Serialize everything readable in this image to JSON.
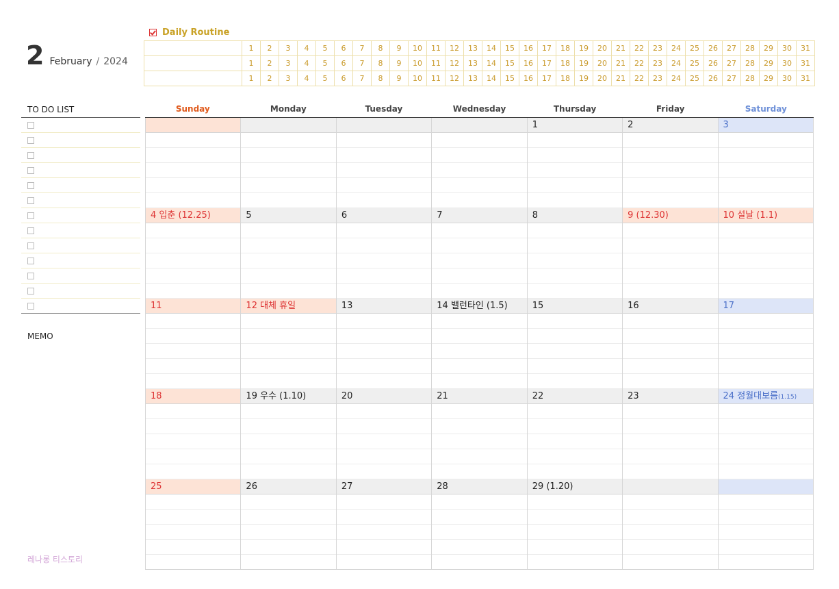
{
  "header": {
    "month_num": "2",
    "month_name": "February",
    "sep": "/",
    "year": "2024"
  },
  "routine": {
    "title": "Daily Routine",
    "days": [
      "1",
      "2",
      "3",
      "4",
      "5",
      "6",
      "7",
      "8",
      "9",
      "10",
      "11",
      "12",
      "13",
      "14",
      "15",
      "16",
      "17",
      "18",
      "19",
      "20",
      "21",
      "22",
      "23",
      "24",
      "25",
      "26",
      "27",
      "28",
      "29",
      "30",
      "31"
    ],
    "rows": 3
  },
  "todo": {
    "title": "TO DO LIST",
    "count": 13
  },
  "memo": {
    "title": "MEMO"
  },
  "brand": "레나롱 티스토리",
  "weekdays": [
    "Sunday",
    "Monday",
    "Tuesday",
    "Wednesday",
    "Thursday",
    "Friday",
    "Saturday"
  ],
  "weeks": [
    [
      {
        "label": "",
        "kind": "empty"
      },
      {
        "label": "",
        "kind": "empty"
      },
      {
        "label": "",
        "kind": "empty"
      },
      {
        "label": "",
        "kind": "empty"
      },
      {
        "label": "1",
        "kind": "normal"
      },
      {
        "label": "2",
        "kind": "normal"
      },
      {
        "label": "3",
        "kind": "normal"
      }
    ],
    [
      {
        "label": "4  입춘  (12.25)",
        "kind": "holiday"
      },
      {
        "label": "5",
        "kind": "normal"
      },
      {
        "label": "6",
        "kind": "normal"
      },
      {
        "label": "7",
        "kind": "normal"
      },
      {
        "label": "8",
        "kind": "normal"
      },
      {
        "label": "9  (12.30)",
        "kind": "holiday"
      },
      {
        "label": "10  설날  (1.1)",
        "kind": "holiday"
      }
    ],
    [
      {
        "label": "11",
        "kind": "normal"
      },
      {
        "label": "12  대체  휴일",
        "kind": "holiday"
      },
      {
        "label": "13",
        "kind": "normal"
      },
      {
        "label": "14  밸런타인  (1.5)",
        "kind": "normal"
      },
      {
        "label": "15",
        "kind": "normal"
      },
      {
        "label": "16",
        "kind": "normal"
      },
      {
        "label": "17",
        "kind": "normal"
      }
    ],
    [
      {
        "label": "18",
        "kind": "normal"
      },
      {
        "label": "19  우수  (1.10)",
        "kind": "normal"
      },
      {
        "label": "20",
        "kind": "normal"
      },
      {
        "label": "21",
        "kind": "normal"
      },
      {
        "label": "22",
        "kind": "normal"
      },
      {
        "label": "23",
        "kind": "normal"
      },
      {
        "label": "24  정월대보름",
        "kind": "normal",
        "small": "(1.15)"
      }
    ],
    [
      {
        "label": "25",
        "kind": "normal"
      },
      {
        "label": "26",
        "kind": "normal"
      },
      {
        "label": "27",
        "kind": "normal"
      },
      {
        "label": "28",
        "kind": "normal"
      },
      {
        "label": "29  (1.20)",
        "kind": "normal"
      },
      {
        "label": "",
        "kind": "empty"
      },
      {
        "label": "",
        "kind": "empty"
      }
    ]
  ],
  "colors": {
    "sunday": "#e05a1c",
    "saturday": "#6e90d8",
    "holiday": "#d33333",
    "routine": "#c99a2a"
  }
}
